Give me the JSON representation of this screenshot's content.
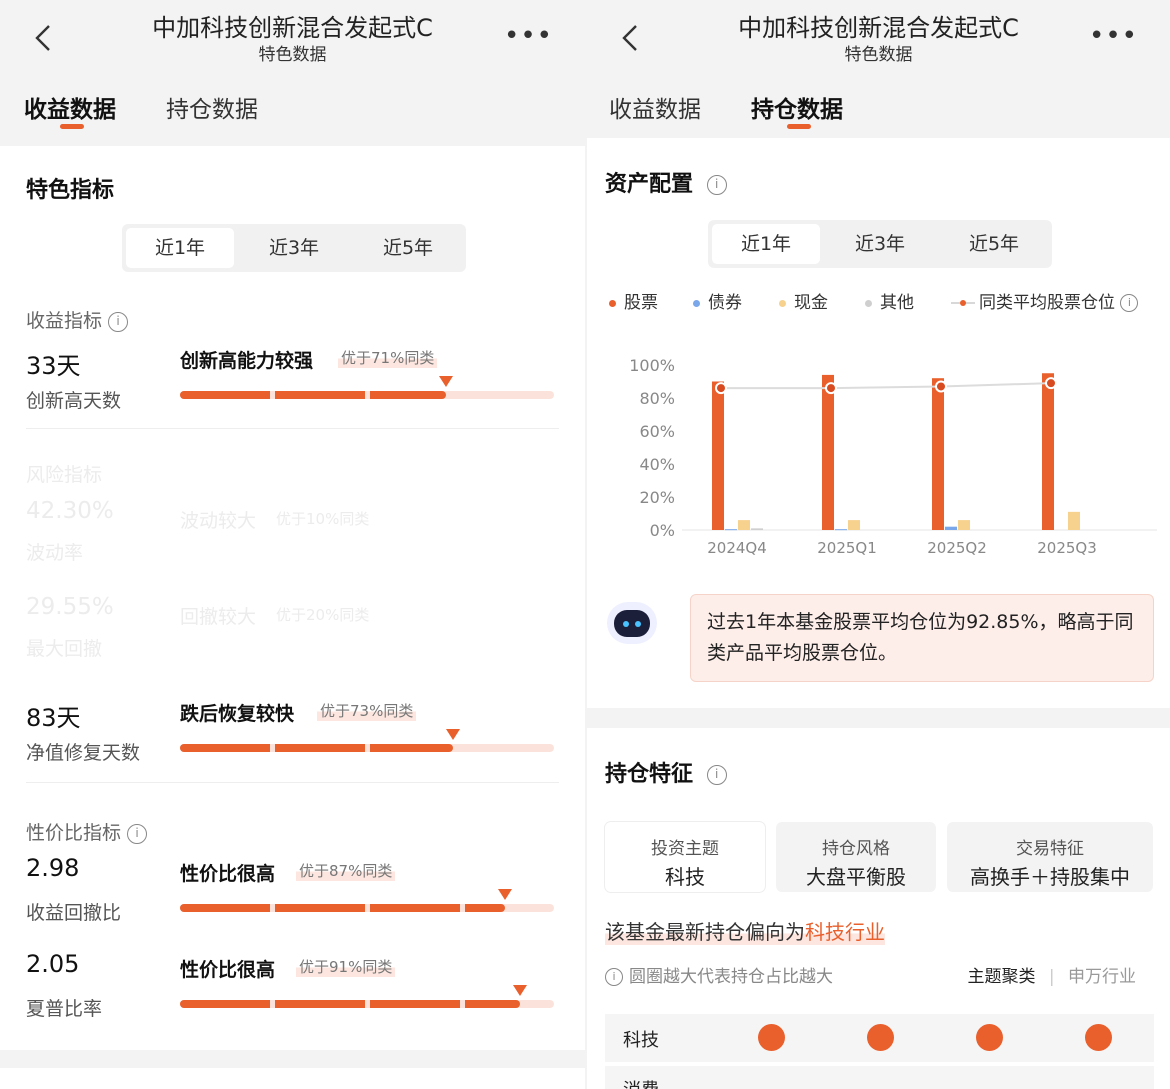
{
  "colors": {
    "accent": "#e9602d",
    "stock": "#e9602d",
    "bond": "#7aa6ea",
    "cash": "#f7d28f",
    "other": "#cfcfcf"
  },
  "left": {
    "header": {
      "title": "中加科技创新混合发起式C",
      "subtitle": "特色数据",
      "back_icon": "chevron-left-icon",
      "more_label": "•••"
    },
    "tabs": [
      {
        "label": "收益数据",
        "active": true
      },
      {
        "label": "持仓数据",
        "active": false
      }
    ],
    "section_title": "特色指标",
    "periods": [
      "近1年",
      "近3年",
      "近5年"
    ],
    "selected_period": "近1年",
    "groups": [
      {
        "title": "收益指标",
        "metrics": [
          {
            "value": "33天",
            "caption": "创新高天数",
            "label": "创新高能力较强",
            "badge": "优于71%同类",
            "percent": 71
          }
        ]
      },
      {
        "title": "风险指标",
        "metrics": [
          {
            "value": "42.30%",
            "caption": "波动率",
            "label": "波动较大",
            "badge": "优于10%同类"
          },
          {
            "value": "29.55%",
            "caption": "最大回撤",
            "label": "回撤较大",
            "badge": "优于20%同类"
          },
          {
            "value": "83天",
            "caption": "净值修复天数",
            "label": "跌后恢复较快",
            "badge": "优于73%同类",
            "percent": 73
          }
        ]
      },
      {
        "title": "性价比指标",
        "metrics": [
          {
            "value": "2.98",
            "caption": "收益回撤比",
            "label": "性价比很高",
            "badge": "优于87%同类",
            "percent": 87
          },
          {
            "value": "2.05",
            "caption": "夏普比率",
            "label": "性价比很高",
            "badge": "优于91%同类",
            "percent": 91
          }
        ]
      }
    ]
  },
  "right": {
    "header": {
      "title": "中加科技创新混合发起式C",
      "subtitle": "特色数据",
      "back_icon": "chevron-left-icon",
      "more_label": "•••"
    },
    "tabs": [
      {
        "label": "收益数据",
        "active": false
      },
      {
        "label": "持仓数据",
        "active": true
      }
    ],
    "asset_title": "资产配置",
    "periods": [
      "近1年",
      "近3年",
      "近5年"
    ],
    "selected_period": "近1年",
    "legend": [
      "股票",
      "债券",
      "现金",
      "其他",
      "同类平均股票仓位"
    ],
    "chart_data": {
      "type": "bar",
      "categories": [
        "2024Q4",
        "2025Q1",
        "2025Q2",
        "2025Q3"
      ],
      "yticks": [
        "0%",
        "20%",
        "40%",
        "60%",
        "80%",
        "100%"
      ],
      "ylim": [
        0,
        100
      ],
      "grid": false,
      "legend": "top",
      "series": [
        {
          "name": "股票",
          "values": [
            90,
            94,
            92,
            95
          ]
        },
        {
          "name": "债券",
          "values": [
            0.5,
            0.5,
            2,
            0
          ]
        },
        {
          "name": "现金",
          "values": [
            6,
            6,
            6,
            11
          ]
        },
        {
          "name": "其他",
          "values": [
            1,
            0,
            0,
            0
          ]
        },
        {
          "name": "同类平均股票仓位",
          "values": [
            86,
            86,
            87,
            89
          ]
        }
      ]
    },
    "summary": "过去1年本基金股票平均仓位为92.85%，略高于同类产品平均股票仓位。",
    "holding_title": "持仓特征",
    "features": [
      {
        "label": "投资主题",
        "value": "科技",
        "active": true
      },
      {
        "label": "持仓风格",
        "value": "大盘平衡股",
        "active": false
      },
      {
        "label": "交易特征",
        "value": "高换手＋持股集中",
        "active": false
      }
    ],
    "note_prefix": "该基金最新持仓偏向为",
    "note_highlight": "科技行业",
    "hint": "圆圈越大代表持仓占比越大",
    "view_switch": [
      "主题聚类",
      "申万行业"
    ],
    "themes": [
      "科技",
      "消费"
    ]
  }
}
